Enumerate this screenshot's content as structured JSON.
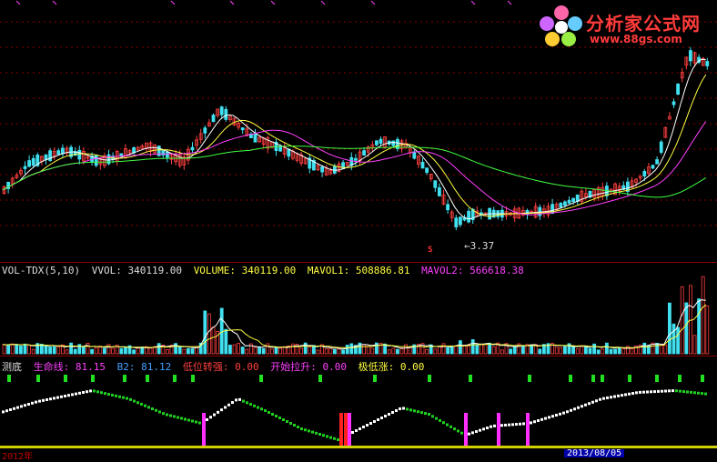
{
  "logo": {
    "main": "分析家公式网",
    "sub": "www.88gs.com"
  },
  "price": {
    "low_label": "3.37",
    "signal_mark": "S"
  },
  "volume_header": {
    "name": "VOL-TDX(5,10)",
    "vvol": "VVOL: 340119.00",
    "volume": "VOLUME: 340119.00",
    "mavol1": "MAVOL1: 508886.81",
    "mavol2": "MAVOL2: 566618.38"
  },
  "indicator_header": {
    "name": "测底",
    "life_line": "生命线: 81.15",
    "b2": "B2: 81.12",
    "low_strong": "低位转强: 0.00",
    "start_rise": "开始拉升: 0.00",
    "extreme_low": "极低涨: 0.00"
  },
  "bottom_axis": {
    "year_label": "2012年",
    "date_tag": "2013/08/05"
  },
  "colors": {
    "up": "#ff4040",
    "down": "#40e0f0",
    "ma_white": "#ffffff",
    "ma_yellow": "#ffff40",
    "ma_magenta": "#ff40ff",
    "ma_green": "#40ff40",
    "grid": "#8a0000"
  }
}
